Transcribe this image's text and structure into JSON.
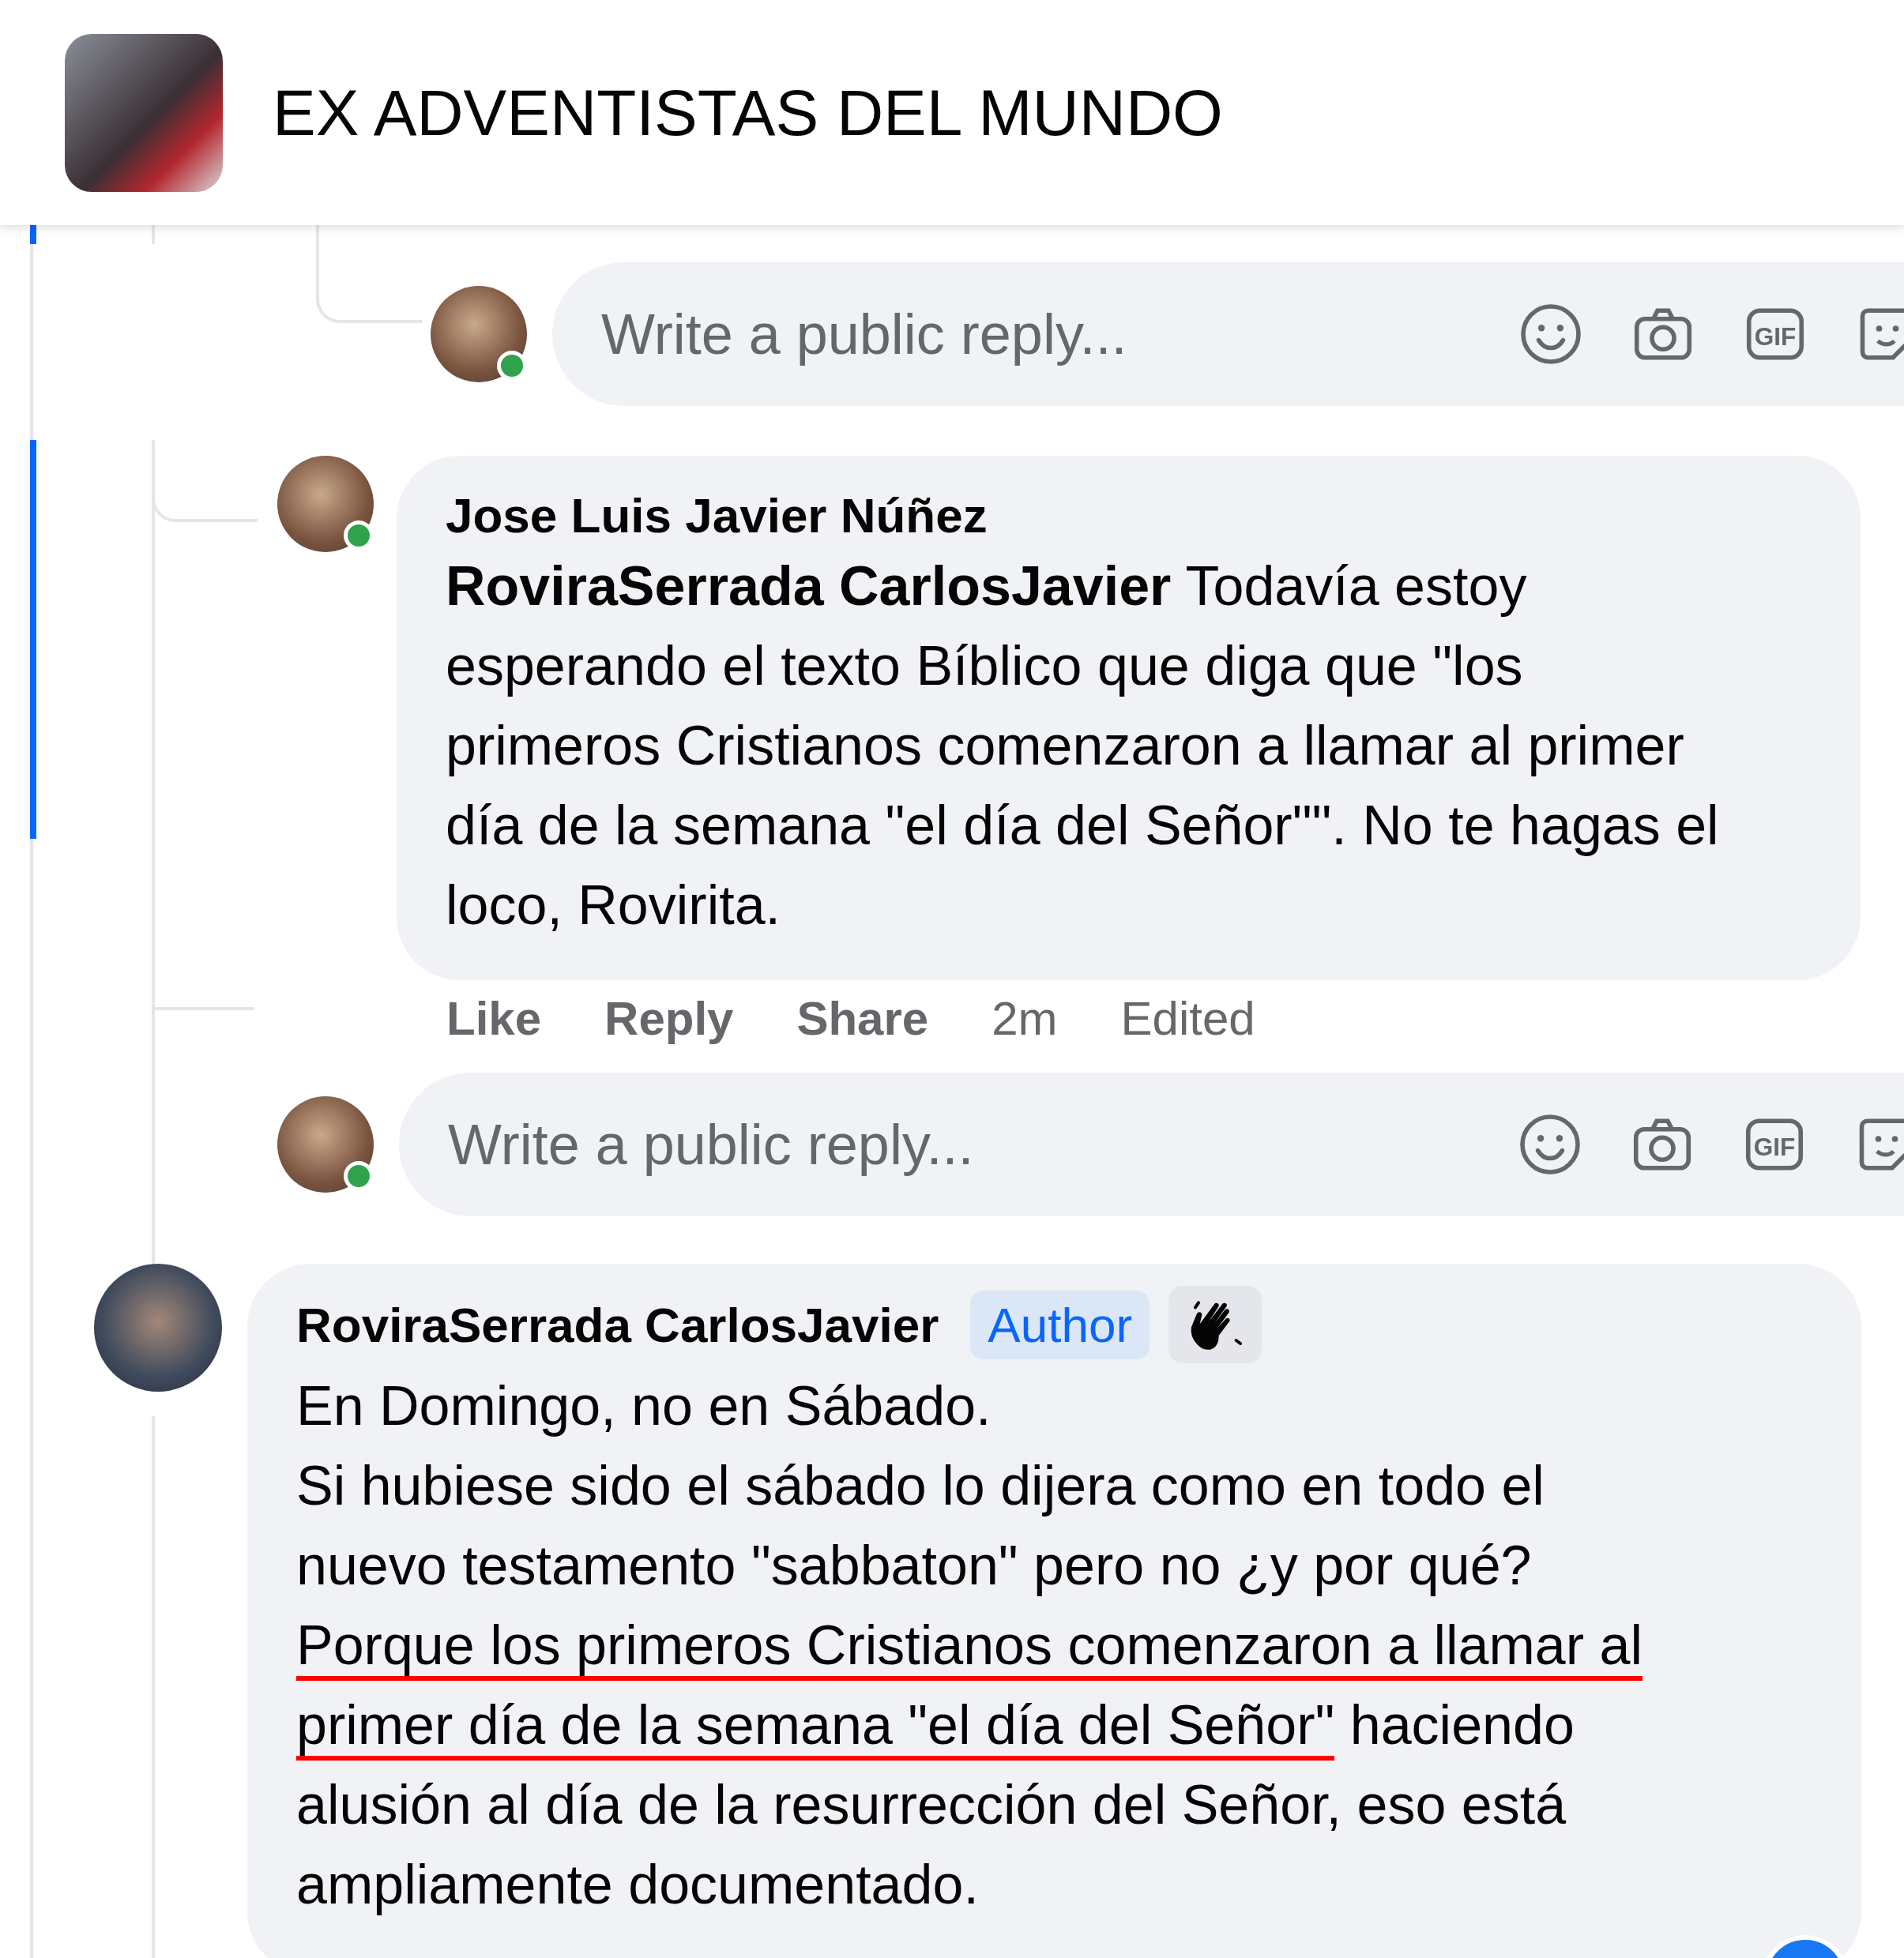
{
  "group": {
    "title": "EX ADVENTISTAS DEL MUNDO"
  },
  "items": [
    {
      "kind": "subreply_box",
      "placeholder": "Write a public reply...",
      "online": true,
      "gif_label": "GIF"
    },
    {
      "kind": "reply",
      "author": "Jose Luis Javier Núñez",
      "online": true,
      "lines": [
        [
          {
            "text": "**RoviraSerrada CarlosJavier** Todavía estoy",
            "underlined": false
          }
        ],
        [
          {
            "text": "esperando el texto Bíblico que diga que \"los",
            "underlined": false
          }
        ],
        [
          {
            "text": "primeros Cristianos comenzaron a llamar al primer",
            "underlined": false
          }
        ],
        [
          {
            "text": "día de la semana \"el día del Señor\"\". No te hagas el",
            "underlined": false
          }
        ],
        [
          {
            "text": "loco, Rovirita.",
            "underlined": false
          }
        ]
      ],
      "actions": [
        "Like",
        "Reply",
        "Share"
      ],
      "time": "2m",
      "edited": "Edited"
    },
    {
      "kind": "reply_box",
      "placeholder": "Write a public reply...",
      "online": true,
      "gif_label": "GIF"
    },
    {
      "kind": "comment",
      "author": "RoviraSerrada CarlosJavier",
      "badge": "Author",
      "wave": true,
      "online": false,
      "reacted": true,
      "lines": [
        [
          {
            "text": "En Domingo, no en Sábado.",
            "underlined": false
          }
        ],
        [
          {
            "text": "Si hubiese sido el sábado lo dijera como en todo el",
            "underlined": false
          }
        ],
        [
          {
            "text": "nuevo testamento \"sabbaton\" pero no ¿y por qué?",
            "underlined": false
          }
        ],
        [
          {
            "text": "Porque los primeros Cristianos comenzaron a llamar al",
            "underlined": true
          }
        ],
        [
          {
            "text": "primer día de la semana \"el día del Señor\"",
            "underlined": true
          },
          {
            "text": " haciendo",
            "underlined": false
          }
        ],
        [
          {
            "text": "alusión al día de la resurrección del Señor, eso está",
            "underlined": false
          }
        ],
        [
          {
            "text": "ampliamente documentado.",
            "underlined": false
          }
        ]
      ]
    }
  ]
}
